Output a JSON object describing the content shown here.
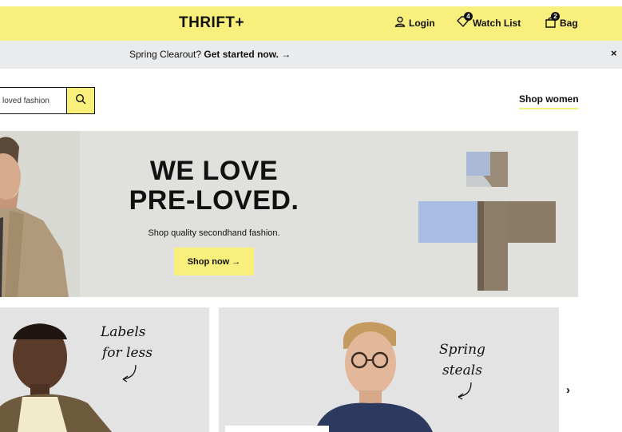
{
  "header": {
    "logo": "THRIFT+",
    "login_label": "Login",
    "watchlist_label": "Watch List",
    "watchlist_count": "4",
    "bag_label": "Bag",
    "bag_count": "2"
  },
  "promo": {
    "text": "Spring Clearout?",
    "cta": "Get started now. →",
    "close": "×"
  },
  "search": {
    "placeholder": "loved fashion"
  },
  "nav": {
    "shop_women": "Shop women"
  },
  "hero": {
    "title_line1": "WE LOVE",
    "title_line2": "PRE-LOVED.",
    "subtitle": "Shop quality secondhand fashion.",
    "cta": "Shop now →"
  },
  "cards": [
    {
      "line1": "Labels",
      "line2": "for less"
    },
    {
      "line1": "Spring",
      "line2": "steals"
    }
  ],
  "carousel": {
    "next": "›"
  },
  "colors": {
    "brand_yellow": "#f8ef7c",
    "promo_gray": "#e9ebec",
    "hero_gray": "#e0e0dc"
  }
}
